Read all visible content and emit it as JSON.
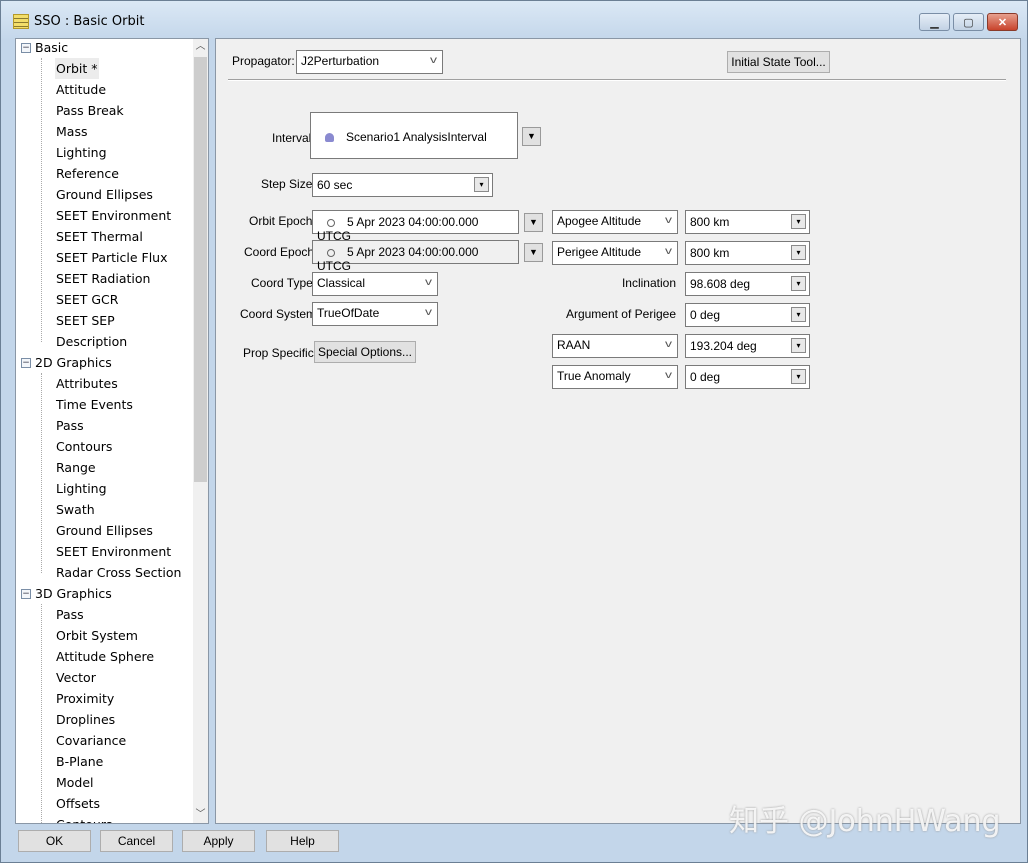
{
  "window": {
    "title": "SSO : Basic Orbit",
    "controls": [
      "minimize",
      "maximize",
      "close"
    ]
  },
  "tree": {
    "groups": [
      {
        "label": "Basic",
        "items": [
          "Orbit *",
          "Attitude",
          "Pass Break",
          "Mass",
          "Lighting",
          "Reference",
          "Ground Ellipses",
          "SEET Environment",
          "SEET Thermal",
          "SEET Particle Flux",
          "SEET Radiation",
          "SEET GCR",
          "SEET SEP",
          "Description"
        ]
      },
      {
        "label": "2D Graphics",
        "items": [
          "Attributes",
          "Time Events",
          "Pass",
          "Contours",
          "Range",
          "Lighting",
          "Swath",
          "Ground Ellipses",
          "SEET Environment",
          "Radar Cross Section"
        ]
      },
      {
        "label": "3D Graphics",
        "items": [
          "Pass",
          "Orbit System",
          "Attitude Sphere",
          "Vector",
          "Proximity",
          "Droplines",
          "Covariance",
          "B-Plane",
          "Model",
          "Offsets",
          "Contours"
        ]
      }
    ],
    "selected": "Orbit *"
  },
  "main": {
    "propagator_label": "Propagator:",
    "propagator": "J2Perturbation",
    "initial_state_button": "Initial State Tool...",
    "interval_label": "Interval:",
    "interval": "Scenario1 AnalysisInterval",
    "step_label": "Step Size:",
    "step": "60 sec",
    "orbit_epoch_label": "Orbit Epoch:",
    "orbit_epoch": "5 Apr 2023 04:00:00.000 UTCG",
    "coord_epoch_label": "Coord Epoch:",
    "coord_epoch": "5 Apr 2023 04:00:00.000 UTCG",
    "coord_type_label": "Coord Type:",
    "coord_type": "Classical",
    "coord_system_label": "Coord System:",
    "coord_system": "TrueOfDate",
    "prop_specific_label": "Prop Specific:",
    "special_options_button": "Special Options...",
    "elements": {
      "apogee_sel": "Apogee Altitude",
      "apogee": "800 km",
      "perigee_sel": "Perigee Altitude",
      "perigee": "800 km",
      "incl_label": "Inclination",
      "incl": "98.608 deg",
      "argp_label": "Argument of Perigee",
      "argp": "0 deg",
      "raan_sel": "RAAN",
      "raan": "193.204 deg",
      "anom_sel": "True Anomaly",
      "anom": "0 deg"
    }
  },
  "buttons": {
    "ok": "OK",
    "cancel": "Cancel",
    "apply": "Apply",
    "help": "Help"
  },
  "watermark": "知乎 @JohnHWang"
}
